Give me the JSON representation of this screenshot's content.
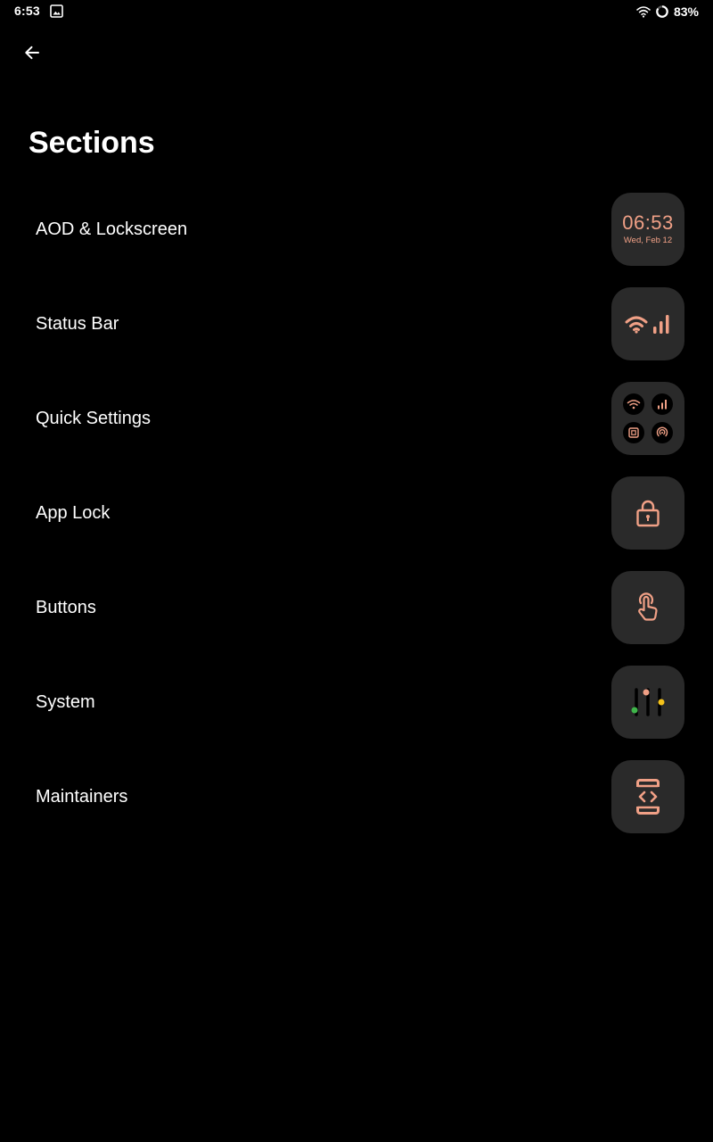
{
  "status_bar": {
    "time": "6:53",
    "battery": "83%",
    "icons": [
      "gallery-icon",
      "wifi-icon",
      "battery-ring-icon"
    ]
  },
  "header": {
    "back_icon": "arrow-left-icon",
    "title": "Sections"
  },
  "sections": [
    {
      "label": "AOD & Lockscreen",
      "icon": "clock-preview",
      "preview_time": "06:53",
      "preview_date": "Wed, Feb 12"
    },
    {
      "label": "Status Bar",
      "icon": "wifi-signal-icon"
    },
    {
      "label": "Quick Settings",
      "icon": "quick-tiles-icon"
    },
    {
      "label": "App Lock",
      "icon": "lock-icon"
    },
    {
      "label": "Buttons",
      "icon": "touch-hand-icon"
    },
    {
      "label": "System",
      "icon": "sliders-icon"
    },
    {
      "label": "Maintainers",
      "icon": "code-phone-icon"
    }
  ],
  "colors": {
    "background": "#000000",
    "tile": "#2a2a2a",
    "accent": "#f0a086",
    "green": "#3fb54a",
    "yellow": "#f4c21a"
  }
}
